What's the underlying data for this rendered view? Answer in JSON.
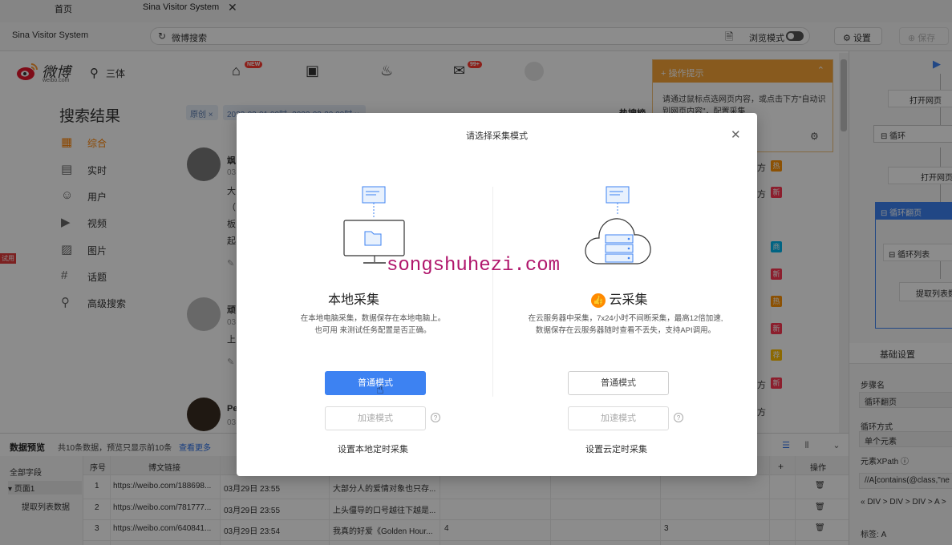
{
  "tabs": [
    {
      "label": "首页"
    },
    {
      "label": "Sina Visitor System"
    }
  ],
  "toolbar": {
    "app_title": "Sina Visitor System",
    "address": "微博搜索",
    "browse_mode_label": "浏览模式",
    "settings_label": "设置",
    "save_label": "保存"
  },
  "weibo": {
    "logo_text": "微博",
    "logo_sub": "weibo.com",
    "search_query": "三体",
    "badge_new": "NEW",
    "badge_msg": "99+",
    "heading": "搜索结果",
    "filters": [
      {
        "label": "原创 ×"
      },
      {
        "label": "2023-03-01 00时- 2023-03-30 00时 ×"
      },
      {
        "label": "热搜榜"
      }
    ],
    "sidebar": [
      {
        "label": "综合",
        "icon": "grid-icon"
      },
      {
        "label": "实时",
        "icon": "realtime-icon"
      },
      {
        "label": "用户",
        "icon": "users-icon"
      },
      {
        "label": "视频",
        "icon": "video-icon"
      },
      {
        "label": "图片",
        "icon": "image-icon"
      },
      {
        "label": "话题",
        "icon": "hashtag-icon"
      },
      {
        "label": "高级搜索",
        "icon": "search-icon"
      }
    ],
    "feed": [
      {
        "name": "飒",
        "date": "03",
        "l1": "大",
        "l2": "（",
        "l3": "板",
        "l4": "起"
      },
      {
        "name": "顽",
        "date": "03",
        "l1": "上"
      },
      {
        "name": "Pe",
        "date": "03"
      }
    ],
    "hot_items": [
      {
        "label": "方",
        "tag": "热",
        "color": "#ff9406"
      },
      {
        "label": "方",
        "tag": "新",
        "color": "#ff3852"
      },
      {
        "label": "",
        "tag": "商",
        "color": "#00b7ee"
      },
      {
        "label": "",
        "tag": "新",
        "color": "#ff3852"
      },
      {
        "label": "",
        "tag": "热",
        "color": "#ff9406"
      },
      {
        "label": "",
        "tag": "新",
        "color": "#ff3852"
      },
      {
        "label": "",
        "tag": "荐",
        "color": "#ffc000"
      },
      {
        "label": "方",
        "tag": "新",
        "color": "#ff3852"
      },
      {
        "label": "方",
        "tag": "",
        "color": "#ffffff"
      }
    ]
  },
  "tip": {
    "title": "操作提示",
    "body": "请通过鼠标点选网页内容，或点击下方\"自动识别网页内容\"，配置采集"
  },
  "preview": {
    "title": "数据预览",
    "count": "共10条数据，预览只显示前10条",
    "more": "查看更多",
    "tree": {
      "all": "全部字段",
      "page": "页面1",
      "list": "提取列表数据"
    },
    "columns": [
      "序号",
      "博文链接",
      "",
      "",
      "",
      "",
      "",
      "+",
      "操作"
    ],
    "rows": [
      {
        "idx": "1",
        "link": "https://weibo.com/188698...",
        "time": "03月29日 23:55",
        "text": "大部分人的爱情对象也只存...",
        "c5": "",
        "c7": ""
      },
      {
        "idx": "2",
        "link": "https://weibo.com/781777...",
        "time": "03月29日 23:55",
        "text": "上头僵导的口号越往下越是...",
        "c5": "",
        "c7": ""
      },
      {
        "idx": "3",
        "link": "https://weibo.com/640841...",
        "time": "03月29日 23:54",
        "text": "我真的好爱《Golden Hour...",
        "c5": "4",
        "c7": "3"
      }
    ]
  },
  "flow": {
    "open_page_1": "打开网页",
    "loop": "循环",
    "open_page_2": "打开网页",
    "loop_page": "循环翻页",
    "loop_list": "循环列表",
    "extract": "提取列表数据"
  },
  "props": {
    "tab": "基础设置",
    "step_name_label": "步骤名",
    "step_name": "循环翻页",
    "loop_type_label": "循环方式",
    "loop_type": "单个元素",
    "xpath_label": "元素XPath",
    "xpath": "//A[contains(@class,\"ne",
    "path": "« DIV > DIV > DIV > A >",
    "tag_label": "标签:",
    "tag": "A"
  },
  "modal": {
    "title": "请选择采集模式",
    "local": {
      "heading": "本地采集",
      "desc1": "在本地电脑采集，数据保存在本地电脑上。",
      "desc2": "也可用 来测试任务配置是否正确。",
      "btn_normal": "普通模式",
      "btn_fast": "加速模式",
      "link": "设置本地定时采集"
    },
    "cloud": {
      "heading": "云采集",
      "desc1": "在云服务器中采集，7x24小时不间断采集，最高12倍加速,",
      "desc2": "数据保存在云服务器随时查看不丢失，支持API调用。",
      "btn_normal": "普通模式",
      "btn_fast": "加速模式",
      "link": "设置云定时采集"
    }
  },
  "watermark": "songshuhezi.com",
  "side_tag": "试用",
  "colors": {
    "accent": "#3d82f2",
    "tip": "#f7a437",
    "weibo_orange": "#ff8200",
    "watermark": "#b0166c"
  }
}
